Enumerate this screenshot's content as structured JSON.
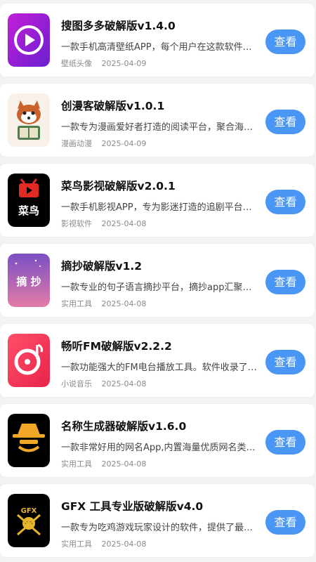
{
  "apps": [
    {
      "title": "搜图多多破解版v1.4.0",
      "description": "一款手机高清壁纸APP，每个用户在这款软件当中…",
      "category": "壁纸头像",
      "date": "2025-04-09",
      "button": "查看",
      "icon": "play-icon"
    },
    {
      "title": "创漫客破解版v1.0.1",
      "description": "一款专为漫画爱好者打造的阅读平台，聚合海量正…",
      "category": "漫画动漫",
      "date": "2025-04-09",
      "button": "查看",
      "icon": "panda-reading-icon"
    },
    {
      "title": "菜鸟影视破解版v2.0.1",
      "description": "一款手机影视APP，专为影迷打造的追剧平台，汇…",
      "category": "影视软件",
      "date": "2025-04-08",
      "button": "查看",
      "icon": "tv-bird-icon",
      "icon_text": "菜鸟"
    },
    {
      "title": "摘抄破解版v1.2",
      "description": "一款专业的句子语言摘抄平台，摘抄app汇聚各种…",
      "category": "实用工具",
      "date": "2025-04-08",
      "button": "查看",
      "icon": "zhaichao-icon",
      "icon_text": "摘 抄"
    },
    {
      "title": "畅听FM破解版v2.2.2",
      "description": "一款功能强大的FM电台播放工具。软件收录了国…",
      "category": "小说音乐",
      "date": "2025-04-08",
      "button": "查看",
      "icon": "music-disc-icon"
    },
    {
      "title": "名称生成器破解版v1.6.0",
      "description": "一款非常好用的网名App,内置海量优质网名类型，…",
      "category": "实用工具",
      "date": "2025-04-08",
      "button": "查看",
      "icon": "hat-spy-icon"
    },
    {
      "title": "GFX 工具专业版破解版v4.0",
      "description": "一款专为吃鸡游戏玩家设计的软件，提供了最佳分…",
      "category": "实用工具",
      "date": "2025-04-08",
      "button": "查看",
      "icon": "gfx-skull-icon",
      "icon_text": "GFX"
    }
  ],
  "colors": {
    "button": "#4a96f5",
    "background": "#f3f3f5"
  }
}
